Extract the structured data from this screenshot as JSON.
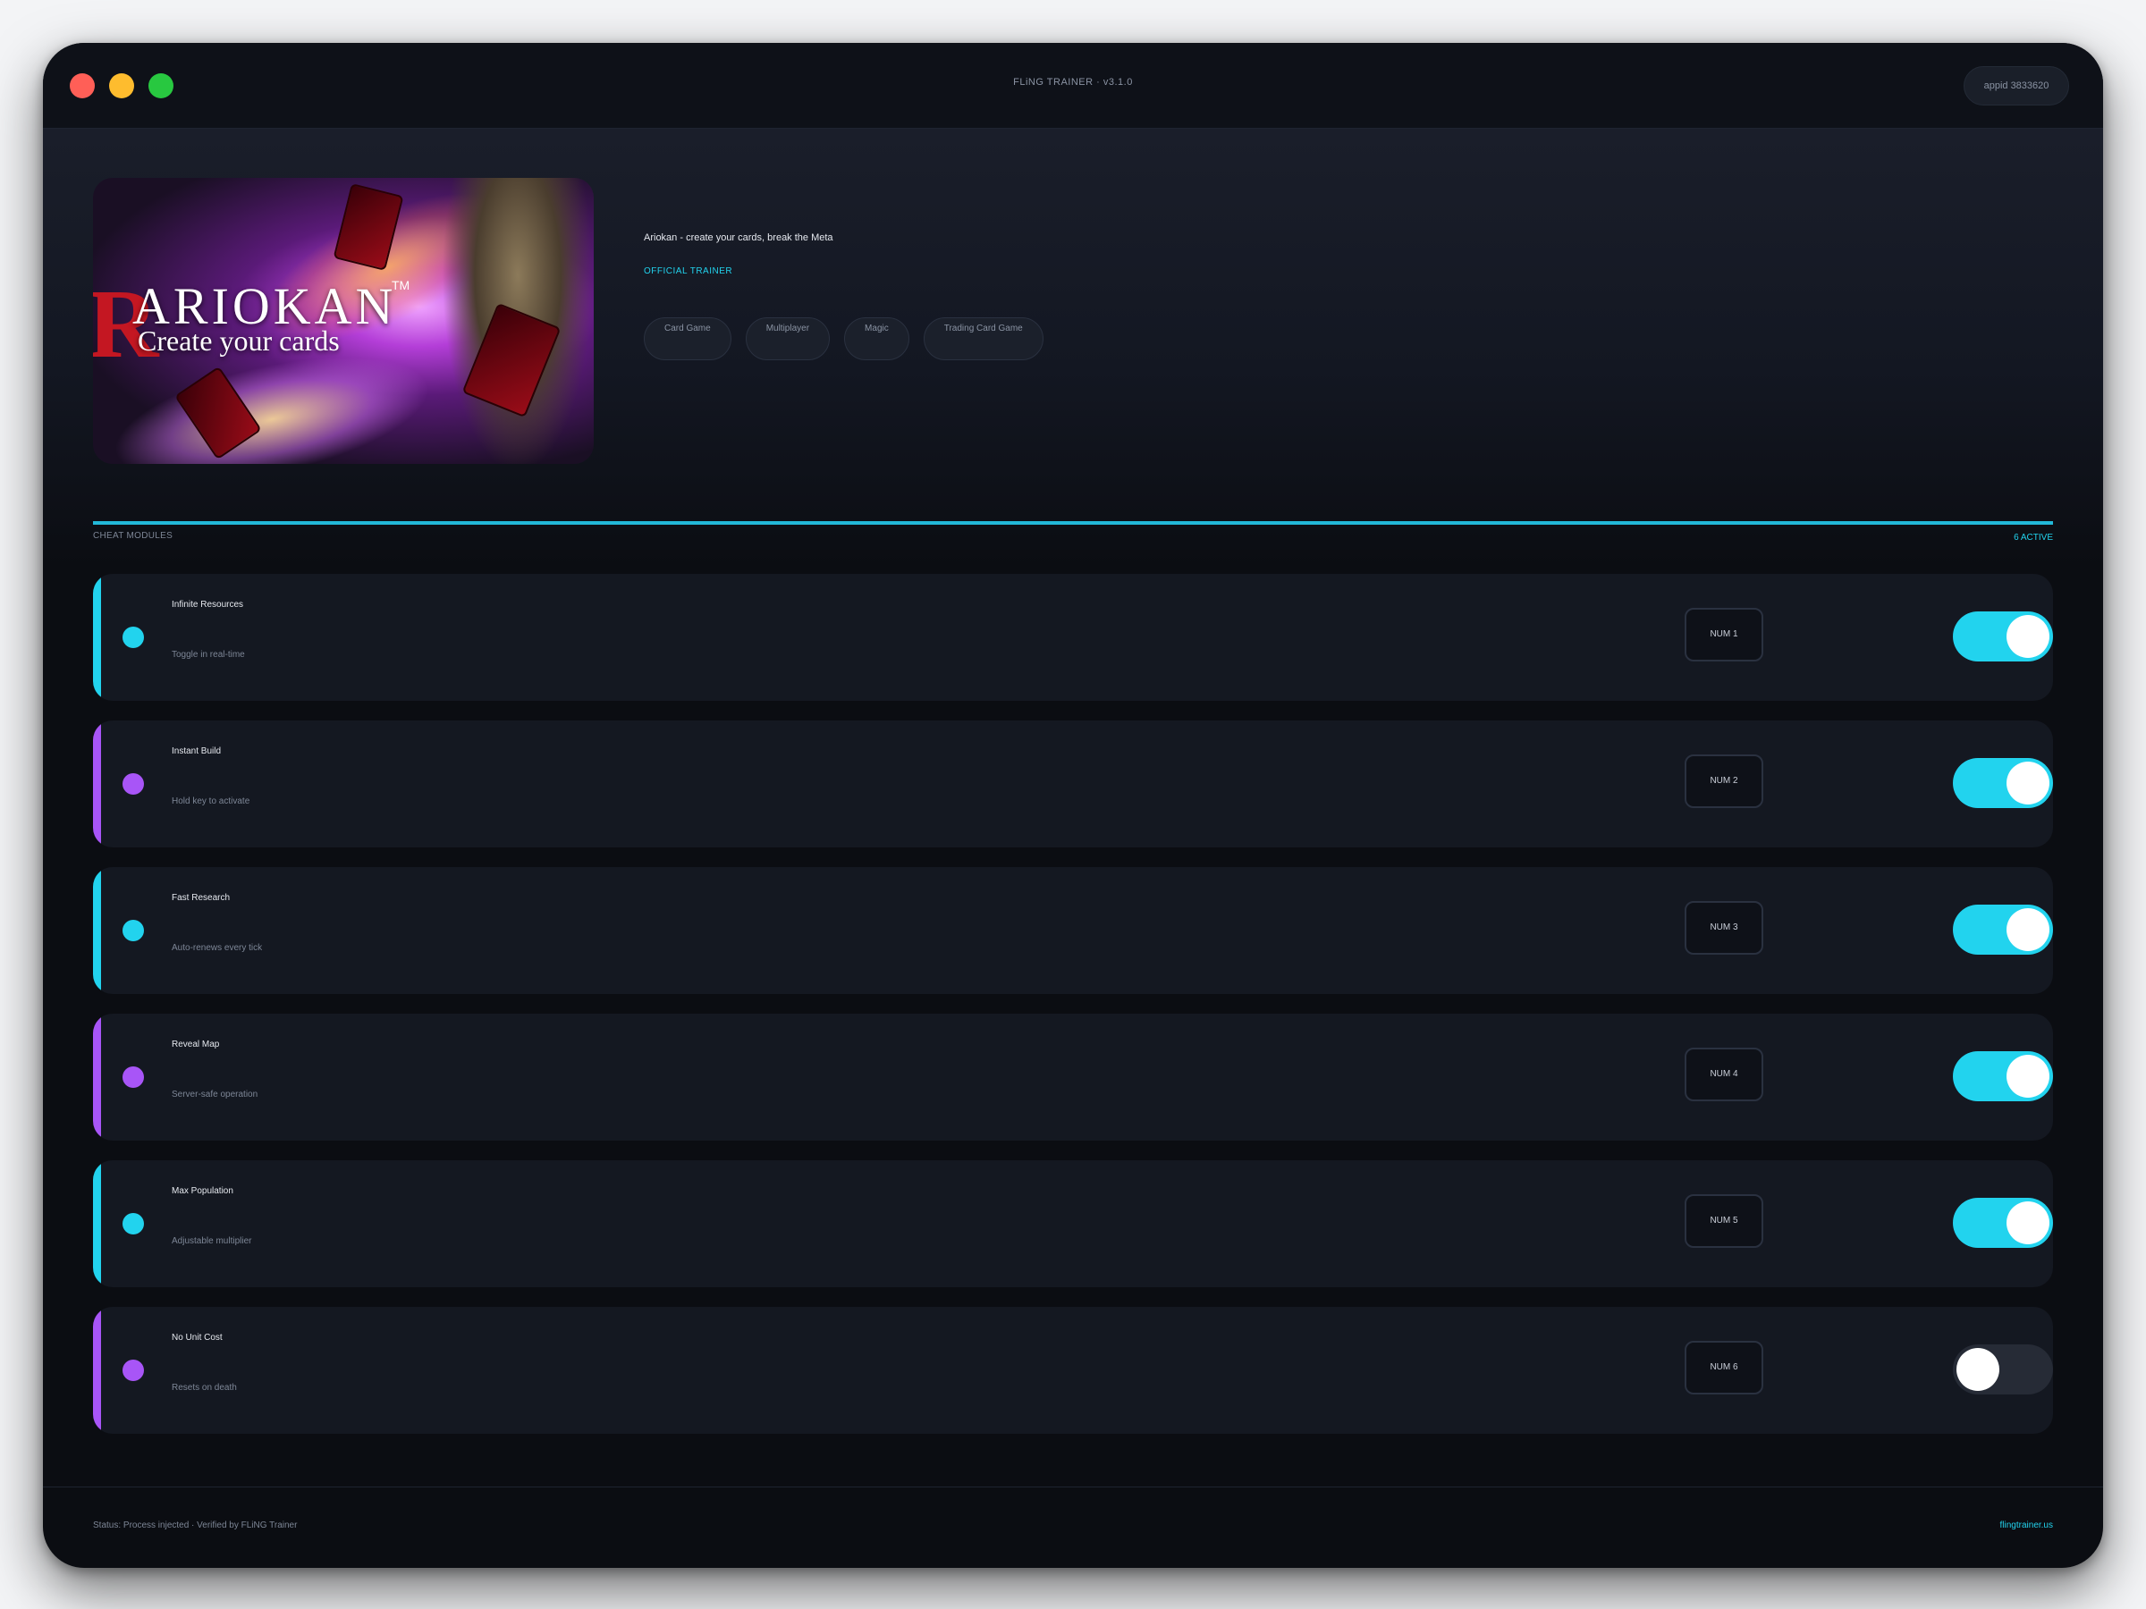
{
  "window": {
    "title": "FLiNG TRAINER · v3.1.0",
    "appid": "appid 3833620"
  },
  "game": {
    "cover_logo": "ARIOKAN",
    "cover_tagline": "Create your cards",
    "title": "Ariokan - create your cards, break the Meta",
    "badge": "OFFICIAL TRAINER",
    "tags": [
      "Card Game",
      "Multiplayer",
      "Magic",
      "Trading Card Game"
    ]
  },
  "section": {
    "label": "CHEAT MODULES",
    "active_count": "6 ACTIVE"
  },
  "cheats": [
    {
      "name": "Infinite Resources",
      "desc": "Toggle in real-time",
      "key": "NUM 1",
      "enabled": true,
      "accent": "cyan"
    },
    {
      "name": "Instant Build",
      "desc": "Hold key to activate",
      "key": "NUM 2",
      "enabled": true,
      "accent": "purple"
    },
    {
      "name": "Fast Research",
      "desc": "Auto-renews every tick",
      "key": "NUM 3",
      "enabled": true,
      "accent": "cyan"
    },
    {
      "name": "Reveal Map",
      "desc": "Server-safe operation",
      "key": "NUM 4",
      "enabled": true,
      "accent": "purple"
    },
    {
      "name": "Max Population",
      "desc": "Adjustable multiplier",
      "key": "NUM 5",
      "enabled": true,
      "accent": "cyan"
    },
    {
      "name": "No Unit Cost",
      "desc": "Resets on death",
      "key": "NUM 6",
      "enabled": false,
      "accent": "purple"
    }
  ],
  "footer": {
    "status": "Status: Process injected · Verified by FLiNG Trainer",
    "link": "flingtrainer.us"
  },
  "colors": {
    "accent_cyan": "#22d3ee",
    "accent_purple": "#a855f7",
    "background": "#0b0d12",
    "row_background": "#141821"
  }
}
